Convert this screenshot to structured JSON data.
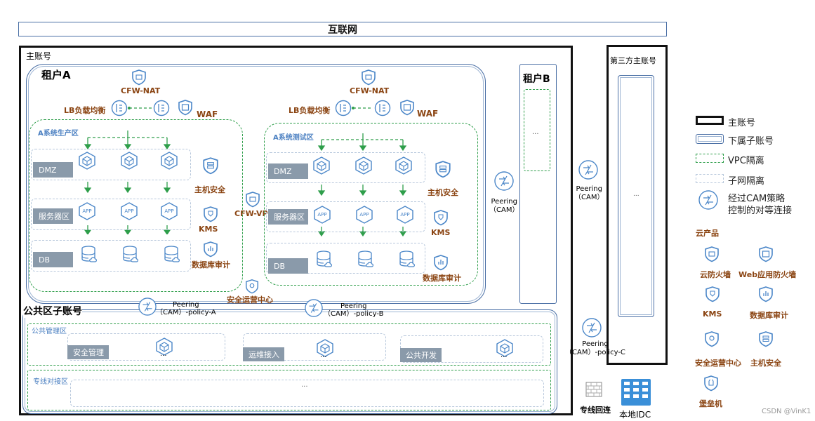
{
  "internet": "互联网",
  "main_account": "主账号",
  "tenant_a": {
    "title": "租户A",
    "cfw_nat": "CFW-NAT",
    "lb": "LB负载均衡",
    "waf": "WAF",
    "prod_zone": "A系统生产区",
    "test_zone": "A系统测试区",
    "dmz": "DMZ",
    "server_zone": "服务器区",
    "db": "DB",
    "host_security": "主机安全",
    "kms": "KMS",
    "db_audit": "数据库审计",
    "cfw_vpc": "CFW-VPC",
    "soc": "安全运营中心"
  },
  "tenant_b": {
    "title": "租户B",
    "dots": "..."
  },
  "third_party": {
    "title": "第三方主账号",
    "dots": "..."
  },
  "peering_cam": "Peering\n（CAM）",
  "public_zone": {
    "title": "公共区子账号",
    "mgmt_zone": "公共管理区",
    "security_mgmt": "安全管理",
    "ops_access": "运维接入",
    "public_dev": "公共开发",
    "dedicated_zone": "专线对接区",
    "dots": "···",
    "peering_a": "Peering\n（CAM）-policy-A",
    "peering_b": "Peering\n（CAM）-policy-B",
    "peering_c": "Peering\n（CAM）-policy-C"
  },
  "dedicated_line": "专线回连",
  "local_idc": "本地IDC",
  "legend": {
    "main_account": "主账号",
    "sub_account": "下属子账号",
    "vpc_isolation": "VPC隔离",
    "subnet_isolation": "子网隔离",
    "cam_peering": "经过CAM策略\n控制的对等连接",
    "cloud_products": "云产品",
    "cfw": "云防火墙",
    "web_waf": "Web应用防火墙",
    "kms": "KMS",
    "db_audit": "数据库审计",
    "soc": "安全运营中心",
    "host_security": "主机安全",
    "bastion": "堡垒机"
  },
  "watermark": "CSDN @VinK1",
  "colors": {
    "accent_blue": "#4a86c8",
    "brown": "#8B4513",
    "green": "#2e9e4a",
    "chip_gray": "#8a9aaa"
  }
}
